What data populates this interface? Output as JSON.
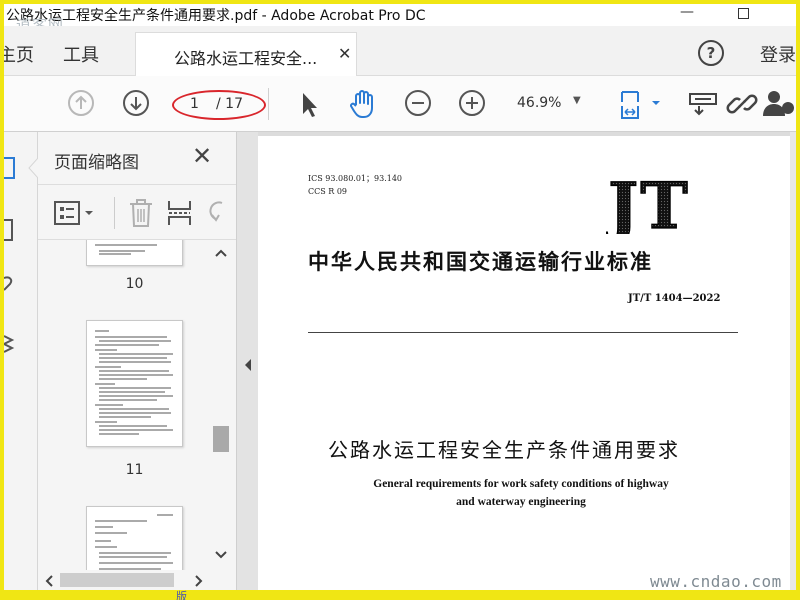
{
  "window": {
    "title": "公路水运工程安全生产条件通用要求.pdf - Adobe Acrobat Pro DC",
    "watermark_top": "道客网",
    "minimize_symbol": "—"
  },
  "menubar": {
    "home": "主页",
    "tools": "工具",
    "doc_tab": "公路水运工程安全...",
    "close_symbol": "✕",
    "help": "?",
    "login": "登录"
  },
  "toolbar": {
    "page_current": "1",
    "page_total": "/ 17",
    "zoom": "46.9%",
    "zoom_arrow": "▼",
    "icons": [
      "arrow-up-icon",
      "arrow-down-icon",
      "pointer-icon",
      "hand-icon",
      "zoom-out-icon",
      "zoom-in-icon",
      "page-fit-icon",
      "printer-icon",
      "link-icon",
      "user-icon"
    ]
  },
  "panel": {
    "title": "页面缩略图",
    "close_symbol": "✕",
    "thumbnails": [
      {
        "label": "10"
      },
      {
        "label": "11"
      }
    ]
  },
  "document": {
    "ics": "ICS 93.080.01；93.140",
    "ccs": "CCS R 09",
    "logo": "JT",
    "standard_title": "中华人民共和国交通运输行业标准",
    "standard_number": "JT/T 1404—2022",
    "main_title": "公路水运工程安全生产条件通用要求",
    "english_line1": "General requirements for work safety conditions of highway",
    "english_line2": "and waterway engineering"
  },
  "watermark_bottom": "www.cndao.com",
  "bottom_fragment": "版"
}
